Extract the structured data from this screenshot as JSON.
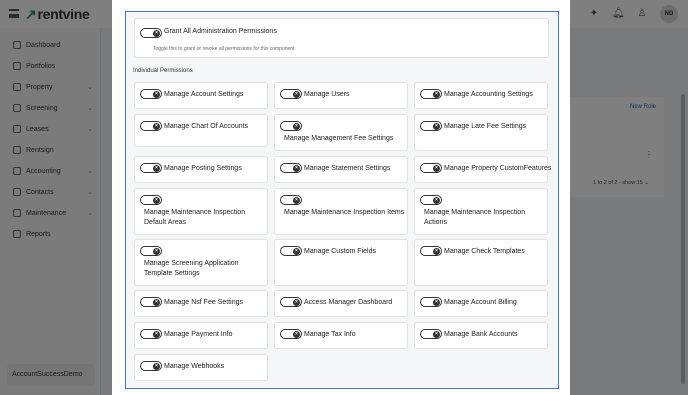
{
  "app": {
    "logo": "rentvine",
    "logo_mark": "↗",
    "user_initials": "ND",
    "account_name": "AccountSuccessDemo"
  },
  "sidebar": {
    "items": [
      {
        "label": "Dashboard",
        "icon": "grid-icon",
        "expandable": false
      },
      {
        "label": "Portfolios",
        "icon": "folder-icon",
        "expandable": false
      },
      {
        "label": "Property",
        "icon": "building-icon",
        "expandable": true
      },
      {
        "label": "Screening",
        "icon": "screen-icon",
        "expandable": true
      },
      {
        "label": "Leases",
        "icon": "document-icon",
        "expandable": true
      },
      {
        "label": "Rentsign",
        "icon": "pen-icon",
        "expandable": false
      },
      {
        "label": "Accounting",
        "icon": "dollar-icon",
        "expandable": true
      },
      {
        "label": "Contacts",
        "icon": "contacts-icon",
        "expandable": true
      },
      {
        "label": "Maintenance",
        "icon": "wrench-icon",
        "expandable": true
      },
      {
        "label": "Reports",
        "icon": "reports-icon",
        "expandable": false
      }
    ]
  },
  "background": {
    "new_role_link": "New Role",
    "pagination": "1 to 2 of 2 - show",
    "page_size": "15"
  },
  "modal": {
    "grant_all": {
      "label": "Grant All Administration Permissions",
      "help": "Toggle this to grant or revoke all permissions for this component",
      "enabled": false
    },
    "section_title": "Individual Permissions",
    "permissions": [
      {
        "label": "Manage Account Settings",
        "enabled": false
      },
      {
        "label": "Manage Users",
        "enabled": false
      },
      {
        "label": "Manage Accounting Settings",
        "enabled": false
      },
      {
        "label": "Manage Chart Of Accounts",
        "enabled": false
      },
      {
        "label": "Manage Management Fee Settings",
        "enabled": false
      },
      {
        "label": "Manage Late Fee Settings",
        "enabled": false
      },
      {
        "label": "Manage Posting Settings",
        "enabled": false
      },
      {
        "label": "Manage Statement Settings",
        "enabled": false
      },
      {
        "label": "Manage Property CustomFeatures",
        "enabled": false
      },
      {
        "label": "Manage Maintenance Inspection Default Areas",
        "enabled": false
      },
      {
        "label": "Manage Maintenance Inspection Items",
        "enabled": false
      },
      {
        "label": "Manage Maintenance Inspection Actions",
        "enabled": false
      },
      {
        "label": "Manage Screening Application Template Settings",
        "enabled": false
      },
      {
        "label": "Manage Custom Fields",
        "enabled": false
      },
      {
        "label": "Manage Check Templates",
        "enabled": false
      },
      {
        "label": "Manage Nsf Fee Settings",
        "enabled": false
      },
      {
        "label": "Access Manager Dashboard",
        "enabled": false
      },
      {
        "label": "Manage Account Billing",
        "enabled": false
      },
      {
        "label": "Manage Payment Info",
        "enabled": false
      },
      {
        "label": "Manage Tax Info",
        "enabled": false
      },
      {
        "label": "Manage Bank Accounts",
        "enabled": false
      },
      {
        "label": "Manage Webhooks",
        "enabled": false
      }
    ]
  },
  "colors": {
    "focus_border": "#3f6fd8",
    "brand_green": "#2f8f5b",
    "toggle_off": "#333333"
  }
}
